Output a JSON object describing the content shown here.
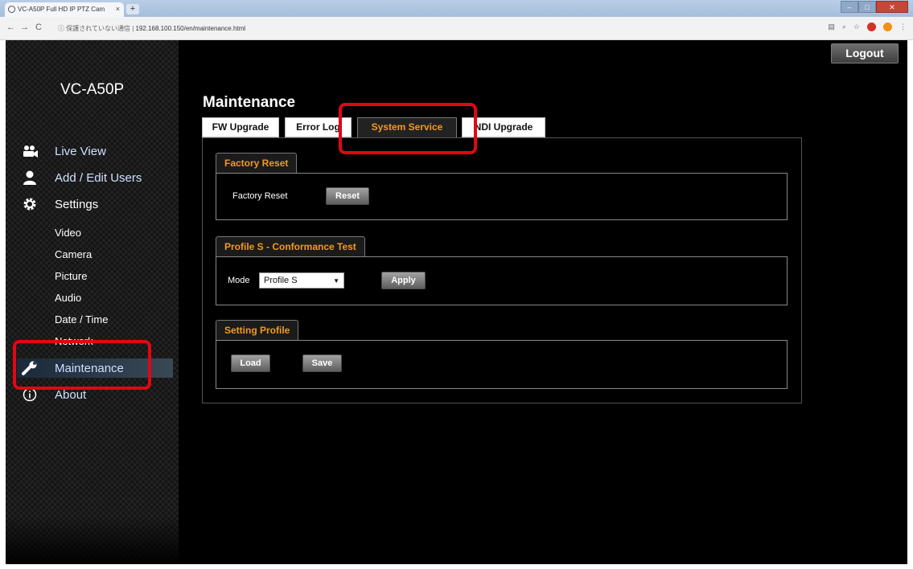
{
  "browser": {
    "tab_title": "VC-A50P Full HD IP PTZ Cam",
    "tab_close": "×",
    "new_tab": "+",
    "nav_back": "←",
    "nav_forward": "→",
    "nav_reload": "C",
    "security_text": "ⓘ 保護されていない通信 |",
    "url": "192.168.100.150/en/maintenance.html",
    "window_min": "–",
    "window_max": "□",
    "window_close": "✕"
  },
  "header": {
    "logout_label": "Logout"
  },
  "sidebar": {
    "model": "VC-A50P",
    "main_items": [
      {
        "label": "Live View",
        "icon": "live-view-icon"
      },
      {
        "label": "Add / Edit Users",
        "icon": "user-icon"
      },
      {
        "label": "Settings",
        "icon": "gear-icon"
      },
      {
        "label": "Maintenance",
        "icon": "wrench-icon"
      },
      {
        "label": "About",
        "icon": "info-icon"
      }
    ],
    "sub_items": [
      "Video",
      "Camera",
      "Picture",
      "Audio",
      "Date / Time",
      "Network"
    ]
  },
  "main": {
    "title": "Maintenance",
    "tabs": [
      {
        "label": "FW Upgrade"
      },
      {
        "label": "Error Log"
      },
      {
        "label": "System Service",
        "active": true
      },
      {
        "label": "NDI Upgrade"
      }
    ],
    "factory_reset": {
      "heading": "Factory Reset",
      "label": "Factory Reset",
      "button": "Reset"
    },
    "profile_s": {
      "heading": "Profile S - Conformance Test",
      "mode_label": "Mode",
      "mode_value": "Profile S",
      "button": "Apply"
    },
    "setting_profile": {
      "heading": "Setting Profile",
      "load_button": "Load",
      "save_button": "Save"
    }
  },
  "colors": {
    "accent": "#f29a1f",
    "annotation": "#e30613",
    "background": "#000000"
  }
}
